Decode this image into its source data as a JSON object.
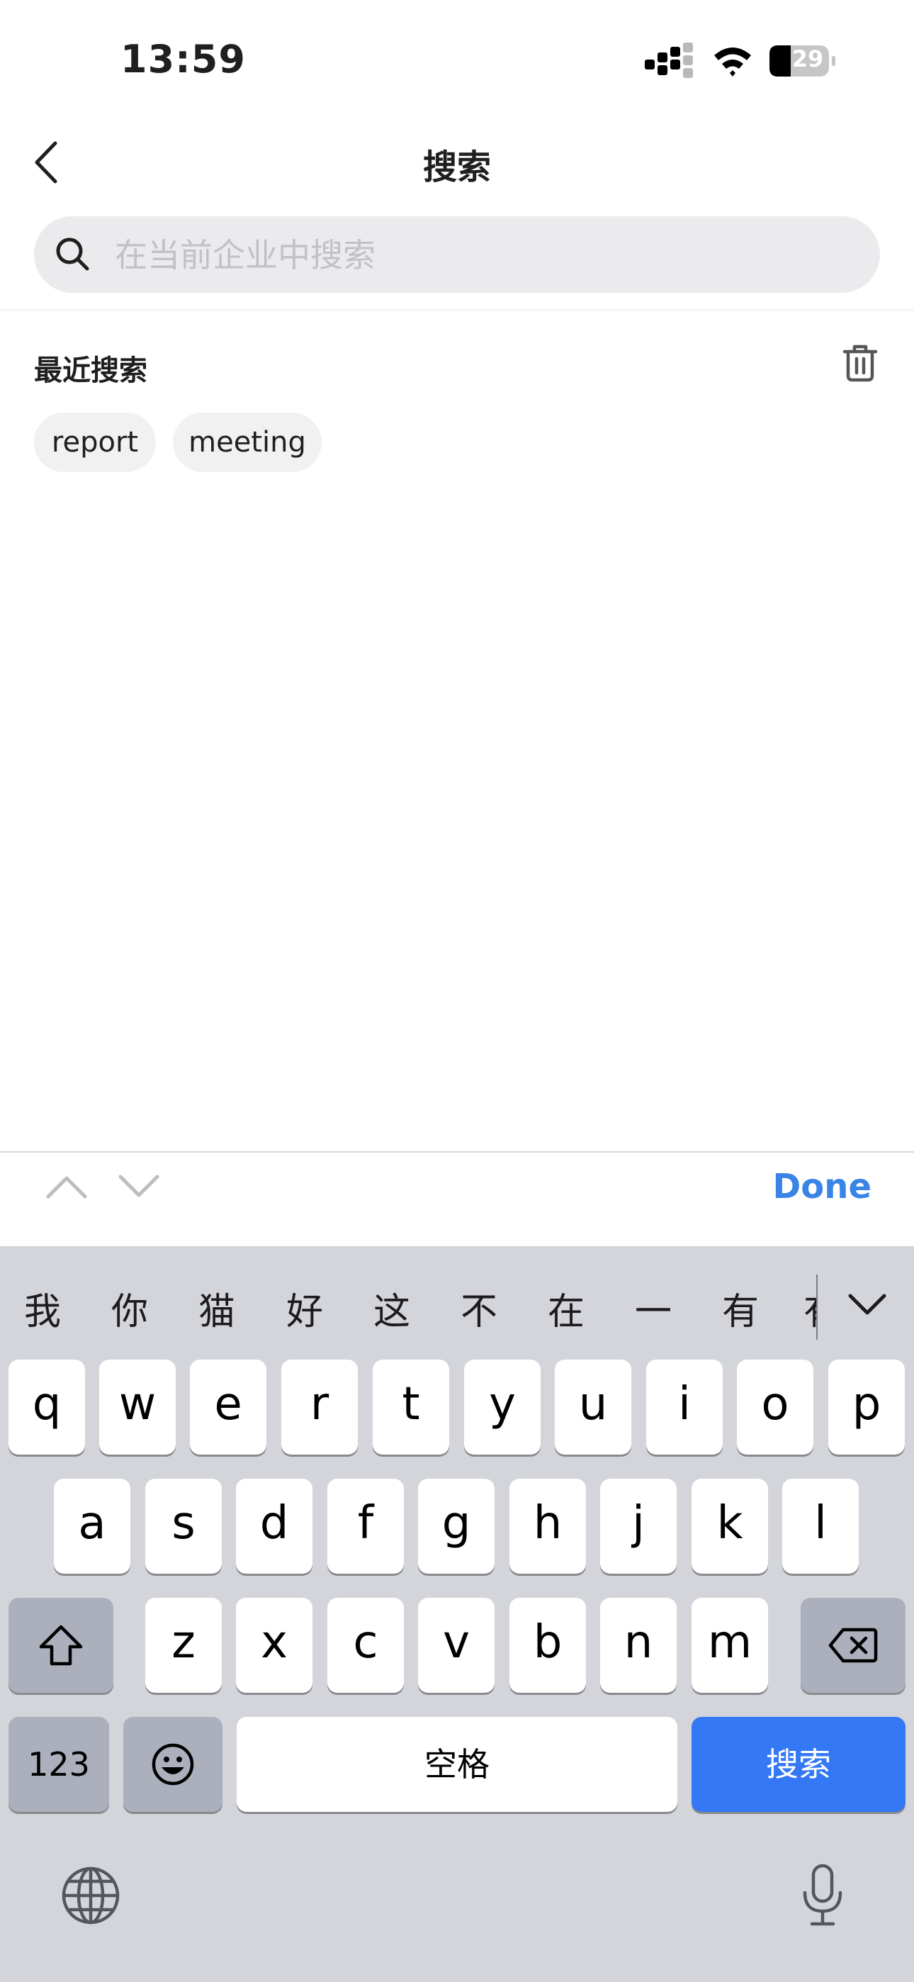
{
  "status_bar": {
    "time": "13:59",
    "battery": "29"
  },
  "nav": {
    "title": "搜索"
  },
  "search": {
    "placeholder": "在当前企业中搜索"
  },
  "recent": {
    "label": "最近搜索",
    "items": [
      "report",
      "meeting"
    ]
  },
  "toolbar": {
    "done_label": "Done"
  },
  "keyboard": {
    "candidates": [
      "我",
      "你",
      "猫",
      "好",
      "这",
      "不",
      "在",
      "一",
      "有"
    ],
    "row1": [
      "q",
      "w",
      "e",
      "r",
      "t",
      "y",
      "u",
      "i",
      "o",
      "p"
    ],
    "row2": [
      "a",
      "s",
      "d",
      "f",
      "g",
      "h",
      "j",
      "k",
      "l"
    ],
    "row3": [
      "z",
      "x",
      "c",
      "v",
      "b",
      "n",
      "m"
    ],
    "numbers_label": "123",
    "space_label": "空格",
    "search_label": "搜索"
  },
  "colors": {
    "accent": "#3478f6",
    "done": "#3a84e6",
    "keyboard_bg": "#d3d5db"
  }
}
